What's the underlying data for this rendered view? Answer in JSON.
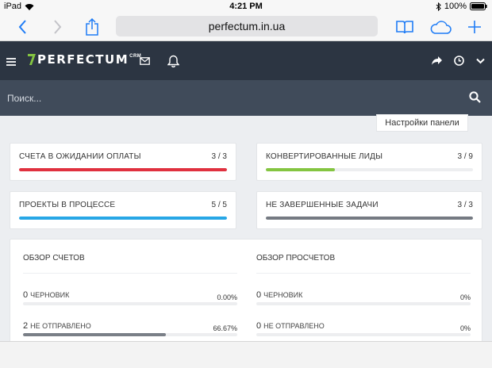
{
  "statusbar": {
    "device": "iPad",
    "time": "4:21 PM",
    "battery": "100%"
  },
  "browser": {
    "url": "perfectum.in.ua"
  },
  "header": {
    "logo_text": "PERFECTUM",
    "logo_sup": "CRM"
  },
  "search": {
    "placeholder": "Поиск..."
  },
  "panel_settings_label": "Настройки панели",
  "stats": [
    {
      "label": "Счета в ожидании оплаты",
      "count": "3 / 3",
      "progress": 1.0,
      "color": "#e0313f"
    },
    {
      "label": "Конвертированные лиды",
      "count": "3 / 9",
      "progress": 0.333,
      "color": "#84c541"
    },
    {
      "label": "Проекты в процессе",
      "count": "5 / 5",
      "progress": 1.0,
      "color": "#27a7e6"
    },
    {
      "label": "Не завершенные задачи",
      "count": "3 / 3",
      "progress": 1.0,
      "color": "#757a82"
    }
  ],
  "invoices_overview": {
    "title": "Обзор счетов",
    "rows": [
      {
        "count": "0",
        "label": "Черновик",
        "percent": "0.00%",
        "progress": 0.0
      },
      {
        "count": "2",
        "label": "Не отправлено",
        "percent": "66.67%",
        "progress": 0.6667
      }
    ]
  },
  "estimates_overview": {
    "title": "Обзор просчетов",
    "rows": [
      {
        "count": "0",
        "label": "Черновик",
        "percent": "0%",
        "progress": 0.0
      },
      {
        "count": "0",
        "label": "Не отправлено",
        "percent": "0%",
        "progress": 0.0
      }
    ]
  },
  "colors": {
    "accent_blue": "#1e7cf6",
    "header_bg": "#2c3542",
    "search_bg": "#404b5a",
    "logo_green": "#84c541"
  }
}
